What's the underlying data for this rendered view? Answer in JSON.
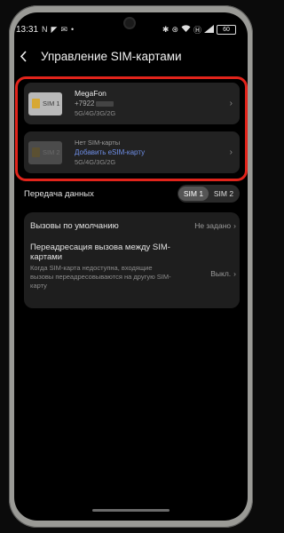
{
  "status_bar": {
    "time": "13:31",
    "left_icons": [
      "N",
      "◤",
      "✉",
      "•"
    ],
    "right_icons": [
      "✱",
      "⊛",
      "Wi-Fi",
      "Ⓗ"
    ],
    "battery": "60"
  },
  "header": {
    "back_icon": "chevron-left-icon",
    "title": "Управление SIM-картами"
  },
  "sim1": {
    "slot_label": "SIM 1",
    "name": "MegaFon",
    "number": "+7922",
    "network": "5G/4G/3G/2G"
  },
  "sim2": {
    "slot_label": "SIM 2",
    "status": "Нет SIM-карты",
    "esim_link": "Добавить eSIM-карту",
    "network": "5G/4G/3G/2G"
  },
  "data_transfer": {
    "label": "Передача данных",
    "options": [
      "SIM 1",
      "SIM 2"
    ],
    "selected": "SIM 1"
  },
  "default_calls": {
    "label": "Вызовы по умолчанию",
    "value": "Не задано"
  },
  "call_forwarding": {
    "title": "Переадресация вызова между SIM-картами",
    "description": "Когда SIM-карта недоступна, входящие вызовы переадресовываются на другую SIM-карту",
    "value": "Выкл."
  },
  "colors": {
    "highlight_border": "#e1241b",
    "link": "#6f8fe8",
    "card_bg": "#222222"
  }
}
